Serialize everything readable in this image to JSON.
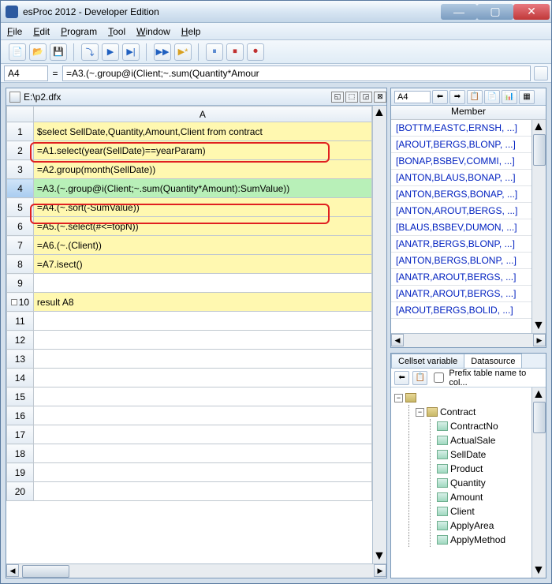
{
  "window": {
    "title": "esProc 2012 - Developer Edition"
  },
  "menu": {
    "file": "File",
    "edit": "Edit",
    "program": "Program",
    "tool": "Tool",
    "window": "Window",
    "help": "Help"
  },
  "formula": {
    "cellref": "A4",
    "value": "=A3.(~.group@i(Client;~.sum(Quantity*Amour"
  },
  "doc": {
    "title": "E:\\p2.dfx"
  },
  "grid": {
    "col": "A",
    "rows": [
      {
        "n": 1,
        "text": "$select SellDate,Quantity,Amount,Client from contract",
        "cls": "yellow"
      },
      {
        "n": 2,
        "text": "=A1.select(year(SellDate)==yearParam)",
        "cls": "yellow"
      },
      {
        "n": 3,
        "text": "=A2.group(month(SellDate))",
        "cls": "yellow"
      },
      {
        "n": 4,
        "text": "=A3.(~.group@i(Client;~.sum(Quantity*Amount):SumValue))",
        "cls": "green",
        "sel": true
      },
      {
        "n": 5,
        "text": "=A4.(~.sort(-SumValue))",
        "cls": "yellow"
      },
      {
        "n": 6,
        "text": "=A5.(~.select(#<=topN))",
        "cls": "yellow"
      },
      {
        "n": 7,
        "text": "=A6.(~.(Client))",
        "cls": "yellow"
      },
      {
        "n": 8,
        "text": "=A7.isect()",
        "cls": "yellow"
      },
      {
        "n": 9,
        "text": "",
        "cls": ""
      },
      {
        "n": 10,
        "text": "result A8",
        "cls": "yellow",
        "mark": true
      },
      {
        "n": 11,
        "text": "",
        "cls": ""
      },
      {
        "n": 12,
        "text": "",
        "cls": ""
      },
      {
        "n": 13,
        "text": "",
        "cls": ""
      },
      {
        "n": 14,
        "text": "",
        "cls": ""
      },
      {
        "n": 15,
        "text": "",
        "cls": ""
      },
      {
        "n": 16,
        "text": "",
        "cls": ""
      },
      {
        "n": 17,
        "text": "",
        "cls": ""
      },
      {
        "n": 18,
        "text": "",
        "cls": ""
      },
      {
        "n": 19,
        "text": "",
        "cls": ""
      },
      {
        "n": 20,
        "text": "",
        "cls": ""
      }
    ]
  },
  "memberPanel": {
    "cellref": "A4",
    "header": "Member",
    "items": [
      "[BOTTM,EASTC,ERNSH, ...]",
      "[AROUT,BERGS,BLONP, ...]",
      "[BONAP,BSBEV,COMMI, ...]",
      "[ANTON,BLAUS,BONAP, ...]",
      "[ANTON,BERGS,BONAP, ...]",
      "[ANTON,AROUT,BERGS, ...]",
      "[BLAUS,BSBEV,DUMON, ...]",
      "[ANATR,BERGS,BLONP, ...]",
      "[ANTON,BERGS,BLONP, ...]",
      "[ANATR,AROUT,BERGS, ...]",
      "[ANATR,AROUT,BERGS, ...]",
      "[AROUT,BERGS,BOLID, ...]"
    ]
  },
  "tabs": {
    "left": "Cellset variable",
    "right": "Datasource"
  },
  "datasource": {
    "prefixLabel": "Prefix table name to col...",
    "table": "Contract",
    "fields": [
      "ContractNo",
      "ActualSale",
      "SellDate",
      "Product",
      "Quantity",
      "Amount",
      "Client",
      "ApplyArea",
      "ApplyMethod"
    ]
  }
}
